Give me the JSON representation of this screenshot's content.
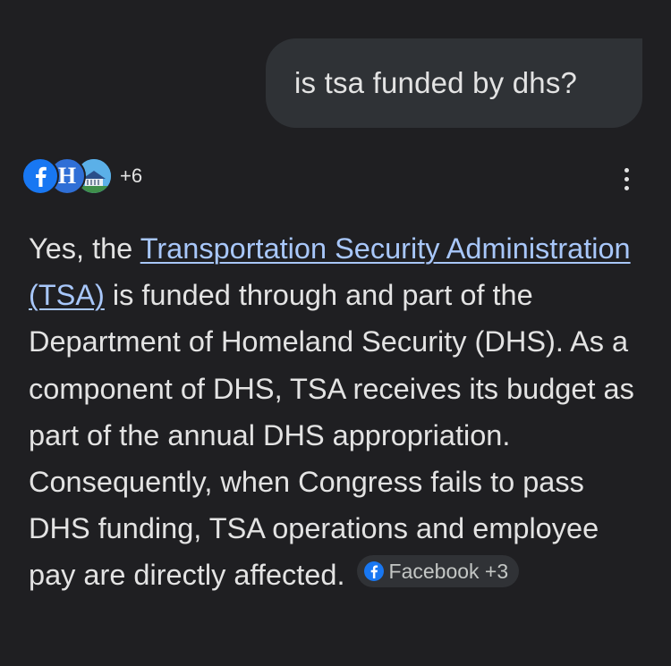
{
  "user_message": {
    "text": "is tsa funded by dhs?"
  },
  "sources": {
    "icons": [
      "facebook-icon",
      "h-site-icon",
      "building-site-icon"
    ],
    "more_count": "+6"
  },
  "answer": {
    "prefix": "Yes, the ",
    "link_text": "Transportation Security Administration (TSA)",
    "body": " is funded through and part of the Department of Homeland Security (DHS). As a component of DHS, TSA receives its budget as part of the annual DHS appropriation. Consequently, when Congress fails to pass DHS funding, TSA operations and employee pay are directly affected.",
    "citation": {
      "label": "Facebook +3",
      "icon": "facebook-icon"
    }
  },
  "colors": {
    "background": "#1f1f22",
    "user_bubble": "#2f3236",
    "link": "#a8c7fa",
    "text": "#e3e3e3",
    "facebook_blue": "#1877f2"
  }
}
